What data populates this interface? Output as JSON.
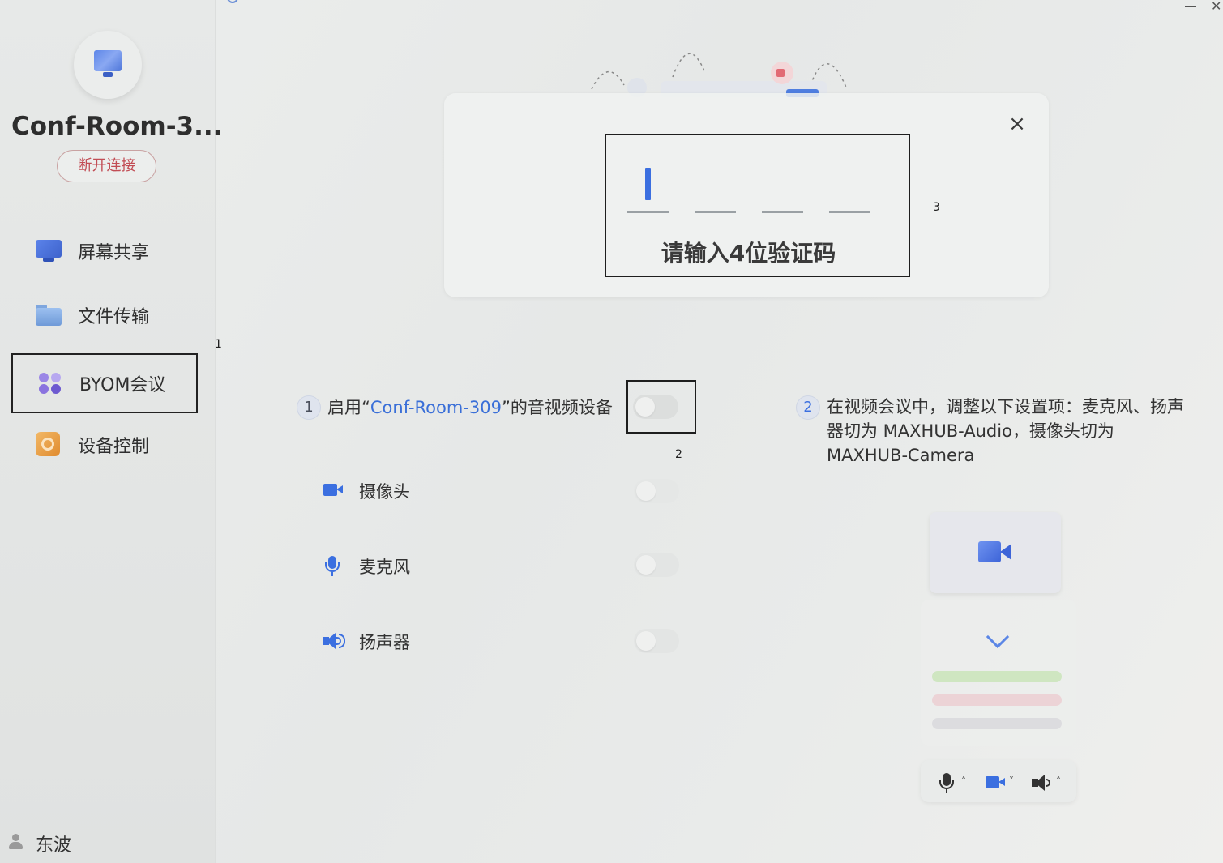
{
  "sidebar": {
    "device_name": "Conf-Room-3...",
    "disconnect_label": "断开连接",
    "items": [
      {
        "label": "屏幕共享",
        "icon": "screen-share-icon"
      },
      {
        "label": "文件传输",
        "icon": "folder-icon"
      },
      {
        "label": "BYOM会议",
        "icon": "byom-icon",
        "active": true
      },
      {
        "label": "设备控制",
        "icon": "device-control-icon"
      }
    ],
    "user_name": "东波"
  },
  "annotations": {
    "n1": "1",
    "n2": "2",
    "n3": "3"
  },
  "dialog": {
    "prompt": "请输入4位验证码"
  },
  "step1": {
    "number": "1",
    "text_prefix": "启用“",
    "room": "Conf-Room-309",
    "text_suffix": "”的音视频设备",
    "devices": [
      {
        "label": "摄像头",
        "icon": "camera-icon"
      },
      {
        "label": "麦克风",
        "icon": "microphone-icon"
      },
      {
        "label": "扬声器",
        "icon": "speaker-icon"
      }
    ]
  },
  "step2": {
    "number": "2",
    "text": "在视频会议中，调整以下设置项：麦克风、扬声器切为 MAXHUB-Audio，摄像头切为 MAXHUB-Camera"
  },
  "colors": {
    "accent": "#3b6fe0",
    "disconnect": "#c24d55"
  }
}
